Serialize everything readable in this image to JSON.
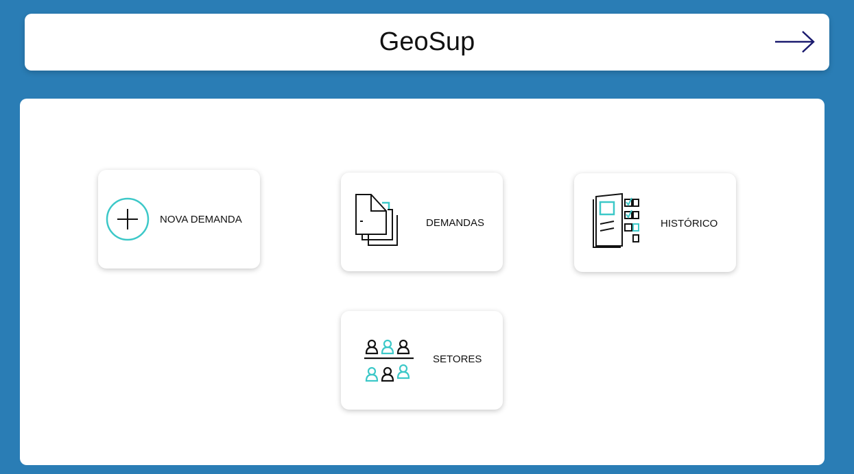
{
  "header": {
    "title": "GeoSup",
    "exit_icon": "arrow-right-icon"
  },
  "menu": {
    "items": [
      {
        "label": "NOVA DEMANDA",
        "icon": "plus-circle-icon"
      },
      {
        "label": "DEMANDAS",
        "icon": "documents-stack-icon"
      },
      {
        "label": "HISTÓRICO",
        "icon": "notebook-checklist-icon"
      },
      {
        "label": "SETORES",
        "icon": "people-sectors-icon"
      }
    ]
  },
  "colors": {
    "background": "#2a7db5",
    "accent": "#3cc8c8",
    "arrow": "#1a1a6e"
  }
}
